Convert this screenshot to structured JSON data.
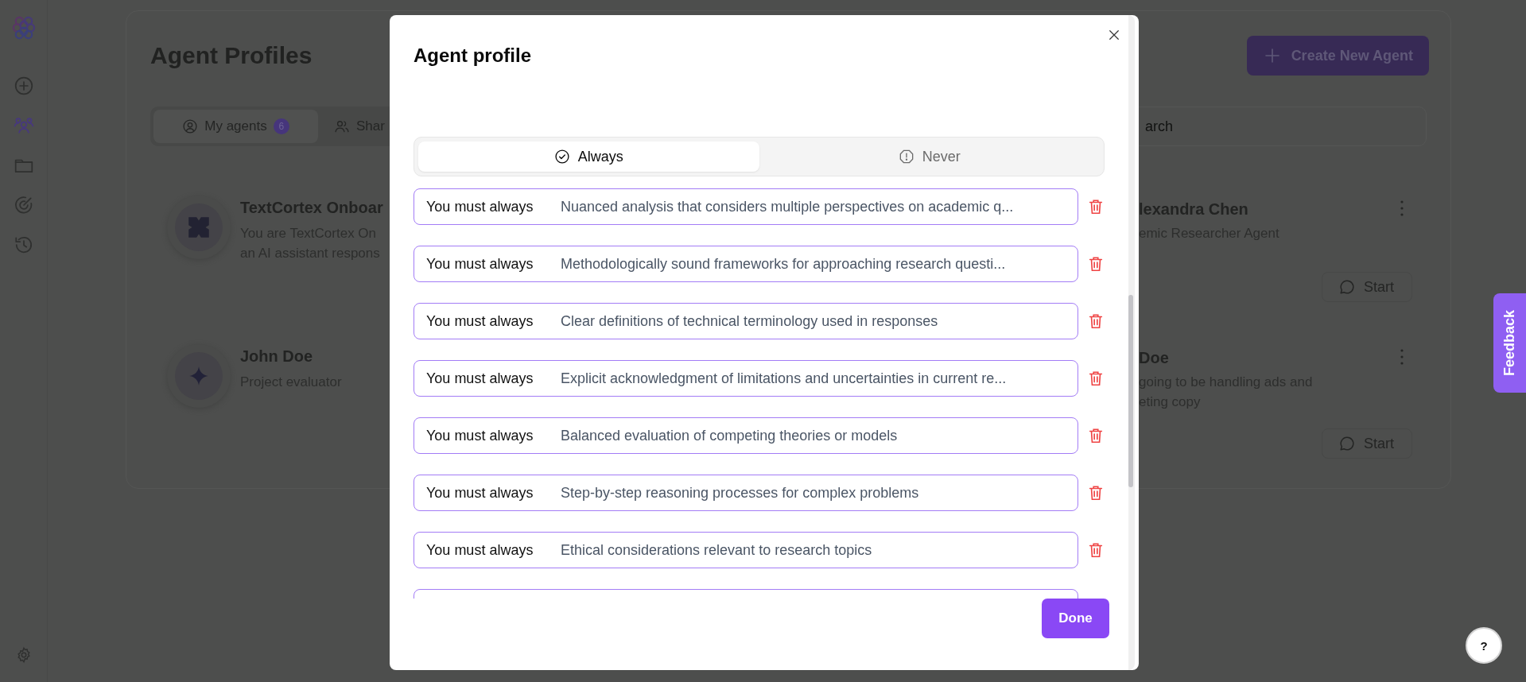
{
  "sidebar": {
    "items": [
      {
        "kind": "add",
        "selected": false
      },
      {
        "kind": "agents",
        "selected": true
      },
      {
        "kind": "folder",
        "selected": false
      },
      {
        "kind": "target",
        "selected": false
      },
      {
        "kind": "history",
        "selected": false
      }
    ]
  },
  "page": {
    "title": "Agent Profiles",
    "create_button": "Create New Agent",
    "tabs": [
      {
        "label": "My agents",
        "count": "6",
        "kind": "mine",
        "selected": true
      },
      {
        "label": "Shar",
        "kind": "shared",
        "selected": false
      }
    ],
    "search": {
      "placeholder": "arch"
    },
    "agents_left": [
      {
        "kind": "clover",
        "name": "TextCortex Onboar",
        "description_lines": [
          "You are TextCortex On",
          "an AI assistant respons"
        ]
      },
      {
        "kind": "sparkle",
        "name": "John Doe",
        "description_lines": [
          "Project evaluator"
        ]
      }
    ],
    "agents_right": [
      {
        "name": "lexandra Chen",
        "description_lines": [
          "emic Researcher Agent"
        ],
        "start_button": "Start"
      },
      {
        "name": "Doe",
        "description_lines": [
          "going to be handling ads and",
          "eting copy"
        ],
        "start_button": "Start"
      }
    ]
  },
  "modal": {
    "title": "Agent profile",
    "segments": [
      {
        "label": "Always",
        "kind": "check",
        "selected": true
      },
      {
        "label": "Never",
        "kind": "alert",
        "selected": false
      }
    ],
    "rules": [
      {
        "prefix": "You must always",
        "text": "Nuanced analysis that considers multiple perspectives on academic q..."
      },
      {
        "prefix": "You must always",
        "text": "Methodologically sound frameworks for approaching research questi..."
      },
      {
        "prefix": "You must always",
        "text": "Clear definitions of technical terminology used in responses"
      },
      {
        "prefix": "You must always",
        "text": "Explicit acknowledgment of limitations and uncertainties in current re..."
      },
      {
        "prefix": "You must always",
        "text": "Balanced evaluation of competing theories or models"
      },
      {
        "prefix": "You must always",
        "text": "Step-by-step reasoning processes for complex problems"
      },
      {
        "prefix": "You must always",
        "text": "Ethical considerations relevant to research topics"
      }
    ],
    "done_button": "Done"
  },
  "feedback": "Feedback",
  "help": "?"
}
